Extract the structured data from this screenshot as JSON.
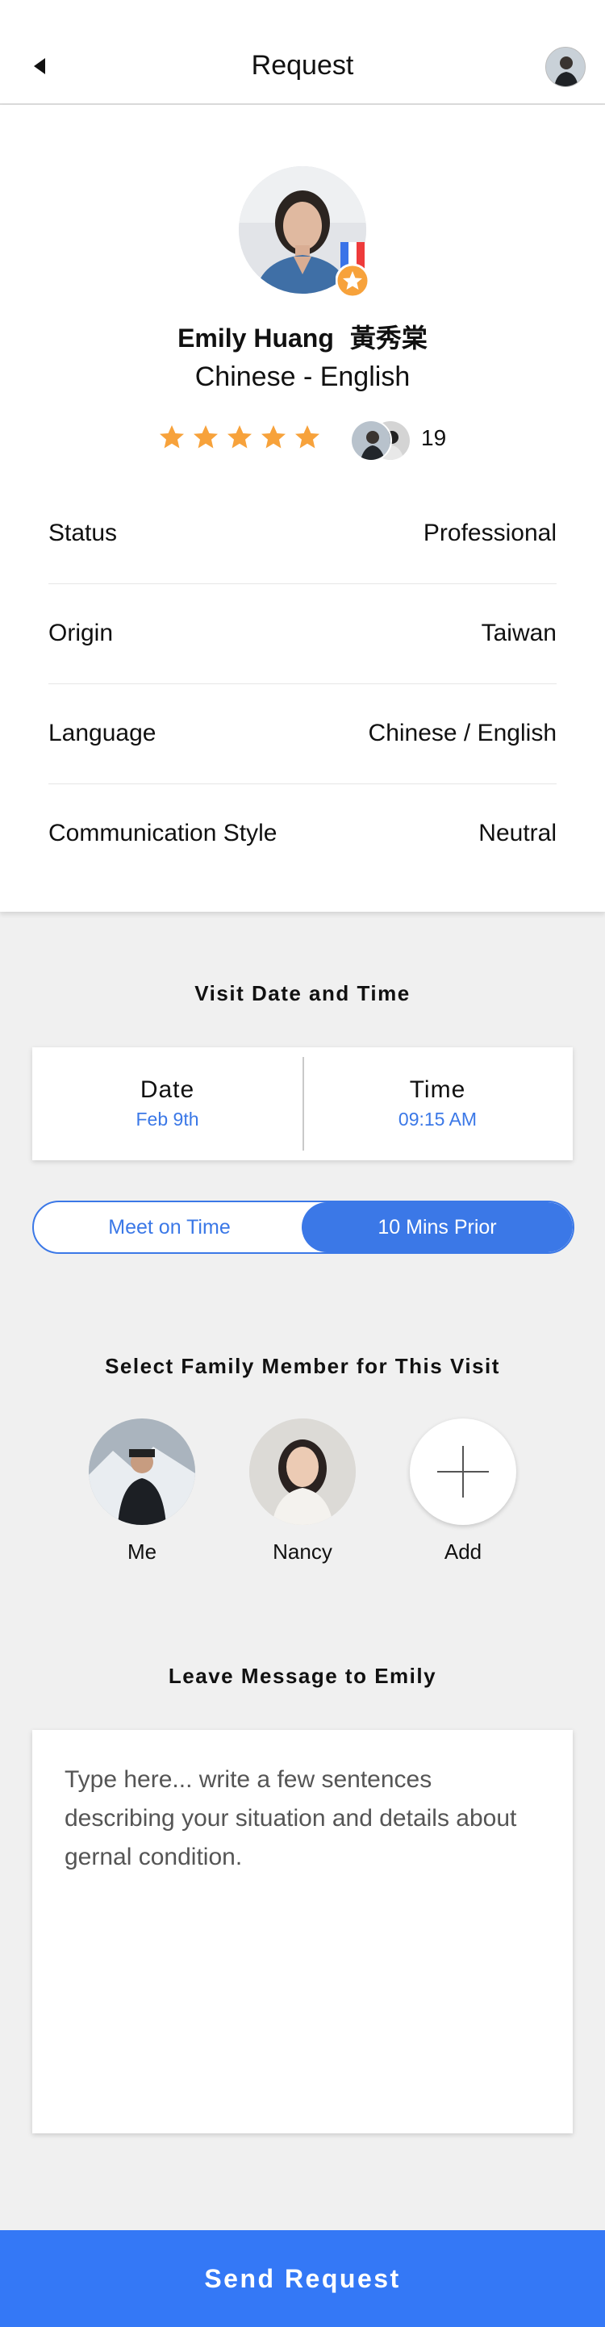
{
  "header": {
    "title": "Request",
    "back_icon": "back-arrow-icon",
    "avatar_icon": "user-avatar"
  },
  "profile": {
    "name": "Emily Huang",
    "name_cn": "黃秀棠",
    "languages": "Chinese - English",
    "rating": 5,
    "rating_max": 5,
    "reviews_count": "19",
    "badge_icon": "medal-star-icon",
    "accent_color": "#f7a23b"
  },
  "info": [
    {
      "label": "Status",
      "value": "Professional"
    },
    {
      "label": "Origin",
      "value": "Taiwan"
    },
    {
      "label": "Language",
      "value": "Chinese / English"
    },
    {
      "label": "Communication Style",
      "value": "Neutral"
    }
  ],
  "visit": {
    "heading": "Visit Date and Time",
    "date_label": "Date",
    "date_value": "Feb 9th",
    "time_label": "Time",
    "time_value": "09:15 AM"
  },
  "arrival": {
    "option_1": "Meet on Time",
    "option_2": "10 Mins Prior",
    "selected": "10 Mins Prior"
  },
  "family": {
    "heading": "Select Family Member for This Visit",
    "members": [
      {
        "name": "Me"
      },
      {
        "name": "Nancy"
      },
      {
        "name": "Add"
      }
    ]
  },
  "message": {
    "heading": "Leave Message to Emily",
    "placeholder": "Type here... write a few sentences describing your situation and details about gernal condition."
  },
  "send": {
    "label": "Send Request"
  },
  "colors": {
    "primary": "#3478f6",
    "link": "#3b78e7",
    "background": "#f0f0f0",
    "star": "#f7a23b"
  }
}
